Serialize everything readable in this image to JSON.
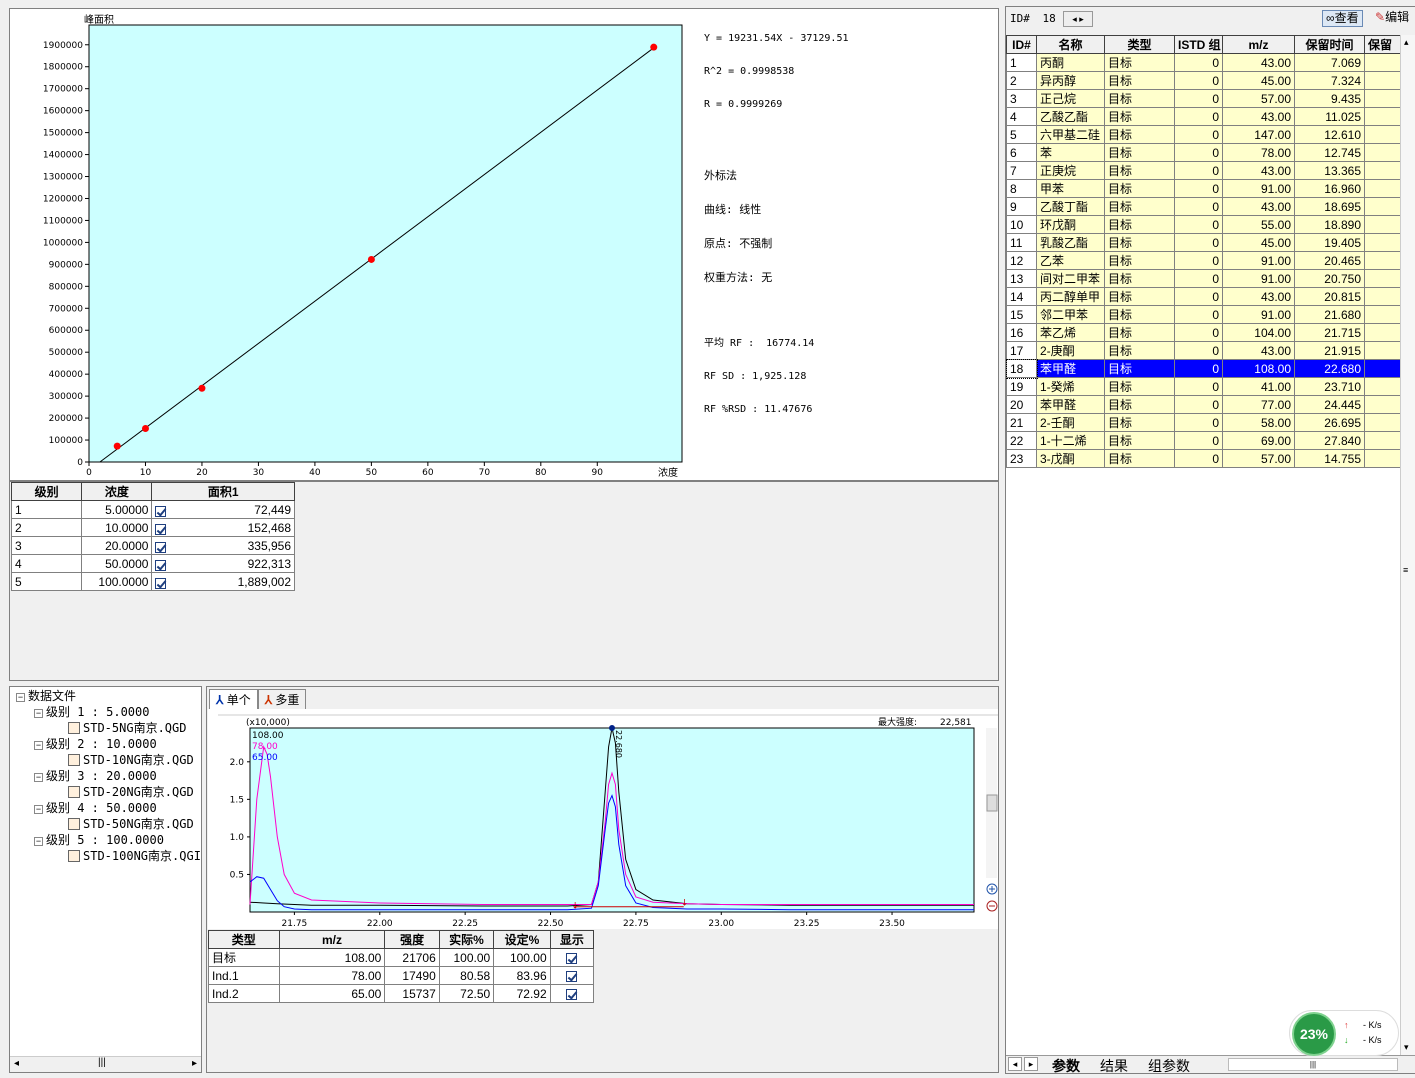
{
  "calib_chart": {
    "ylabel": "峰面积",
    "xlabel": "浓度",
    "y_ticks": [
      "0",
      "100000",
      "200000",
      "300000",
      "400000",
      "500000",
      "600000",
      "700000",
      "800000",
      "900000",
      "1000000",
      "1100000",
      "1200000",
      "1300000",
      "1400000",
      "1500000",
      "1600000",
      "1700000",
      "1800000",
      "1900000"
    ],
    "x_ticks": [
      "0",
      "10",
      "20",
      "30",
      "40",
      "50",
      "60",
      "70",
      "80",
      "90"
    ]
  },
  "chart_data": [
    {
      "type": "scatter",
      "title": "",
      "xlabel": "浓度",
      "ylabel": "峰面积",
      "xlim": [
        0,
        105
      ],
      "ylim": [
        0,
        1990000
      ],
      "points": [
        {
          "x": 5,
          "y": 72449
        },
        {
          "x": 10,
          "y": 152468
        },
        {
          "x": 20,
          "y": 335956
        },
        {
          "x": 50,
          "y": 922313
        },
        {
          "x": 100,
          "y": 1889002
        }
      ],
      "fit_line": {
        "slope": 19231.54,
        "intercept": -37129.51
      },
      "point_color": "#ff0000",
      "background": "#ccffff"
    },
    {
      "type": "line",
      "title": "",
      "xlabel": "",
      "ylabel": "",
      "multiplier_label": "(x10,000)",
      "max_intensity_label": "最大强度:",
      "max_intensity_value": "22,581",
      "xlim": [
        21.62,
        23.74
      ],
      "ylim": [
        0,
        2.45
      ],
      "x_ticks": [
        "21.75",
        "22.00",
        "22.25",
        "22.50",
        "22.75",
        "23.00",
        "23.25",
        "23.50"
      ],
      "y_ticks": [
        "0.5",
        "1.0",
        "1.5",
        "2.0"
      ],
      "peak_label": "22.680",
      "series": [
        {
          "name": "108.00",
          "color": "#000000",
          "x": [
            21.62,
            21.66,
            21.7,
            21.75,
            21.8,
            22.0,
            22.3,
            22.55,
            22.62,
            22.64,
            22.66,
            22.67,
            22.68,
            22.69,
            22.7,
            22.72,
            22.75,
            22.8,
            22.9,
            23.0,
            23.2,
            23.74
          ],
          "y": [
            0.13,
            0.12,
            0.11,
            0.1,
            0.09,
            0.09,
            0.08,
            0.08,
            0.1,
            0.4,
            1.6,
            2.2,
            2.45,
            2.25,
            1.6,
            0.7,
            0.3,
            0.16,
            0.11,
            0.1,
            0.09,
            0.09
          ]
        },
        {
          "name": "78.00",
          "color": "#ff00cc",
          "x": [
            21.62,
            21.64,
            21.66,
            21.67,
            21.68,
            21.7,
            21.72,
            21.75,
            21.8,
            22.0,
            22.3,
            22.55,
            22.62,
            22.64,
            22.66,
            22.67,
            22.68,
            22.69,
            22.7,
            22.72,
            22.75,
            22.8,
            22.9,
            23.0,
            23.2,
            23.74
          ],
          "y": [
            0.1,
            1.5,
            2.2,
            2.1,
            1.8,
            1.0,
            0.5,
            0.25,
            0.16,
            0.12,
            0.1,
            0.1,
            0.1,
            0.4,
            1.2,
            1.7,
            1.85,
            1.7,
            1.1,
            0.5,
            0.2,
            0.13,
            0.11,
            0.1,
            0.1,
            0.1
          ]
        },
        {
          "name": "65.00",
          "color": "#0000ff",
          "x": [
            21.62,
            21.64,
            21.66,
            21.68,
            21.7,
            21.72,
            21.75,
            21.8,
            22.0,
            22.3,
            22.55,
            22.62,
            22.64,
            22.66,
            22.67,
            22.68,
            22.69,
            22.7,
            22.72,
            22.75,
            22.8,
            22.9,
            23.0,
            23.2,
            23.74
          ],
          "y": [
            0.4,
            0.47,
            0.45,
            0.3,
            0.15,
            0.07,
            0.04,
            0.03,
            0.03,
            0.03,
            0.03,
            0.05,
            0.35,
            1.1,
            1.45,
            1.55,
            1.4,
            0.9,
            0.35,
            0.12,
            0.06,
            0.04,
            0.04,
            0.03,
            0.03
          ]
        }
      ],
      "background": "#ccffff"
    }
  ],
  "stats": {
    "line1": "Y = 19231.54X - 37129.51",
    "line2": "R^2 = 0.9998538",
    "line3": "R = 0.9999269",
    "method": "外标法",
    "curve": "曲线: 线性",
    "origin": "原点: 不强制",
    "weight": "权重方法: 无",
    "avg_rf": "平均 RF :  16774.14",
    "rf_sd": "RF SD : 1,925.128",
    "rf_rsd": "RF %RSD : 11.47676"
  },
  "levels_table": {
    "headers": [
      "级别",
      "浓度",
      "面积1"
    ],
    "rows": [
      {
        "level": "1",
        "conc": "5.00000",
        "area": "72,449"
      },
      {
        "level": "2",
        "conc": "10.0000",
        "area": "152,468"
      },
      {
        "level": "3",
        "conc": "20.0000",
        "area": "335,956"
      },
      {
        "level": "4",
        "conc": "50.0000",
        "area": "922,313"
      },
      {
        "level": "5",
        "conc": "100.0000",
        "area": "1,889,002"
      }
    ]
  },
  "tree": {
    "root": "数据文件",
    "levels": [
      {
        "label": "级别 1 : 5.0000",
        "file": "STD-5NG南京.QGD"
      },
      {
        "label": "级别 2 : 10.0000",
        "file": "STD-10NG南京.QGD"
      },
      {
        "label": "级别 3 : 20.0000",
        "file": "STD-20NG南京.QGD"
      },
      {
        "label": "级别 4 : 50.0000",
        "file": "STD-50NG南京.QGD"
      },
      {
        "label": "级别 5 : 100.0000",
        "file": "STD-100NG南京.QGI"
      }
    ]
  },
  "chrom_tabs": {
    "single": "单个",
    "multi": "多重"
  },
  "ion_table": {
    "headers": [
      "类型",
      "m/z",
      "强度",
      "实际%",
      "设定%",
      "显示"
    ],
    "rows": [
      {
        "type": "目标",
        "mz": "108.00",
        "int": "21706",
        "actual": "100.00",
        "set": "100.00"
      },
      {
        "type": "Ind.1",
        "mz": "78.00",
        "int": "17490",
        "actual": "80.58",
        "set": "83.96"
      },
      {
        "type": "Ind.2",
        "mz": "65.00",
        "int": "15737",
        "actual": "72.50",
        "set": "72.92"
      }
    ]
  },
  "right_panel": {
    "id_label": "ID#",
    "id_value": "18",
    "view_button": "查看",
    "edit_button": "编辑",
    "headers": [
      "ID#",
      "名称",
      "类型",
      "ISTD 组",
      "m/z",
      "保留时间",
      "保留"
    ],
    "compounds": [
      {
        "id": "1",
        "name": "丙酮",
        "type": "目标",
        "istd": "0",
        "mz": "43.00",
        "rt": "7.069"
      },
      {
        "id": "2",
        "name": "异丙醇",
        "type": "目标",
        "istd": "0",
        "mz": "45.00",
        "rt": "7.324"
      },
      {
        "id": "3",
        "name": "正己烷",
        "type": "目标",
        "istd": "0",
        "mz": "57.00",
        "rt": "9.435"
      },
      {
        "id": "4",
        "name": "乙酸乙酯",
        "type": "目标",
        "istd": "0",
        "mz": "43.00",
        "rt": "11.025"
      },
      {
        "id": "5",
        "name": "六甲基二硅",
        "type": "目标",
        "istd": "0",
        "mz": "147.00",
        "rt": "12.610"
      },
      {
        "id": "6",
        "name": "苯",
        "type": "目标",
        "istd": "0",
        "mz": "78.00",
        "rt": "12.745"
      },
      {
        "id": "7",
        "name": "正庚烷",
        "type": "目标",
        "istd": "0",
        "mz": "43.00",
        "rt": "13.365"
      },
      {
        "id": "8",
        "name": "甲苯",
        "type": "目标",
        "istd": "0",
        "mz": "91.00",
        "rt": "16.960"
      },
      {
        "id": "9",
        "name": "乙酸丁酯",
        "type": "目标",
        "istd": "0",
        "mz": "43.00",
        "rt": "18.695"
      },
      {
        "id": "10",
        "name": "环戊酮",
        "type": "目标",
        "istd": "0",
        "mz": "55.00",
        "rt": "18.890"
      },
      {
        "id": "11",
        "name": "乳酸乙酯",
        "type": "目标",
        "istd": "0",
        "mz": "45.00",
        "rt": "19.405"
      },
      {
        "id": "12",
        "name": "乙苯",
        "type": "目标",
        "istd": "0",
        "mz": "91.00",
        "rt": "20.465"
      },
      {
        "id": "13",
        "name": "间对二甲苯",
        "type": "目标",
        "istd": "0",
        "mz": "91.00",
        "rt": "20.750"
      },
      {
        "id": "14",
        "name": "丙二醇单甲",
        "type": "目标",
        "istd": "0",
        "mz": "43.00",
        "rt": "20.815"
      },
      {
        "id": "15",
        "name": "邻二甲苯",
        "type": "目标",
        "istd": "0",
        "mz": "91.00",
        "rt": "21.680"
      },
      {
        "id": "16",
        "name": "苯乙烯",
        "type": "目标",
        "istd": "0",
        "mz": "104.00",
        "rt": "21.715"
      },
      {
        "id": "17",
        "name": "2-庚酮",
        "type": "目标",
        "istd": "0",
        "mz": "43.00",
        "rt": "21.915"
      },
      {
        "id": "18",
        "name": "苯甲醛",
        "type": "目标",
        "istd": "0",
        "mz": "108.00",
        "rt": "22.680"
      },
      {
        "id": "19",
        "name": "1-癸烯",
        "type": "目标",
        "istd": "0",
        "mz": "41.00",
        "rt": "23.710"
      },
      {
        "id": "20",
        "name": "苯甲醛",
        "type": "目标",
        "istd": "0",
        "mz": "77.00",
        "rt": "24.445"
      },
      {
        "id": "21",
        "name": "2-壬酮",
        "type": "目标",
        "istd": "0",
        "mz": "58.00",
        "rt": "26.695"
      },
      {
        "id": "22",
        "name": "1-十二烯",
        "type": "目标",
        "istd": "0",
        "mz": "69.00",
        "rt": "27.840"
      },
      {
        "id": "23",
        "name": "3-戊酮",
        "type": "目标",
        "istd": "0",
        "mz": "57.00",
        "rt": "14.755"
      }
    ],
    "selected_id": "18",
    "bottom_tabs": [
      "参数",
      "结果",
      "组参数"
    ]
  },
  "net_widget": {
    "percent": "23%",
    "up": "- K/s",
    "down": "- K/s"
  },
  "colors": {
    "plot_bg": "#ccffff",
    "row_bg": "#ffffcc",
    "selected": "#0000ff",
    "point": "#ff0000"
  }
}
